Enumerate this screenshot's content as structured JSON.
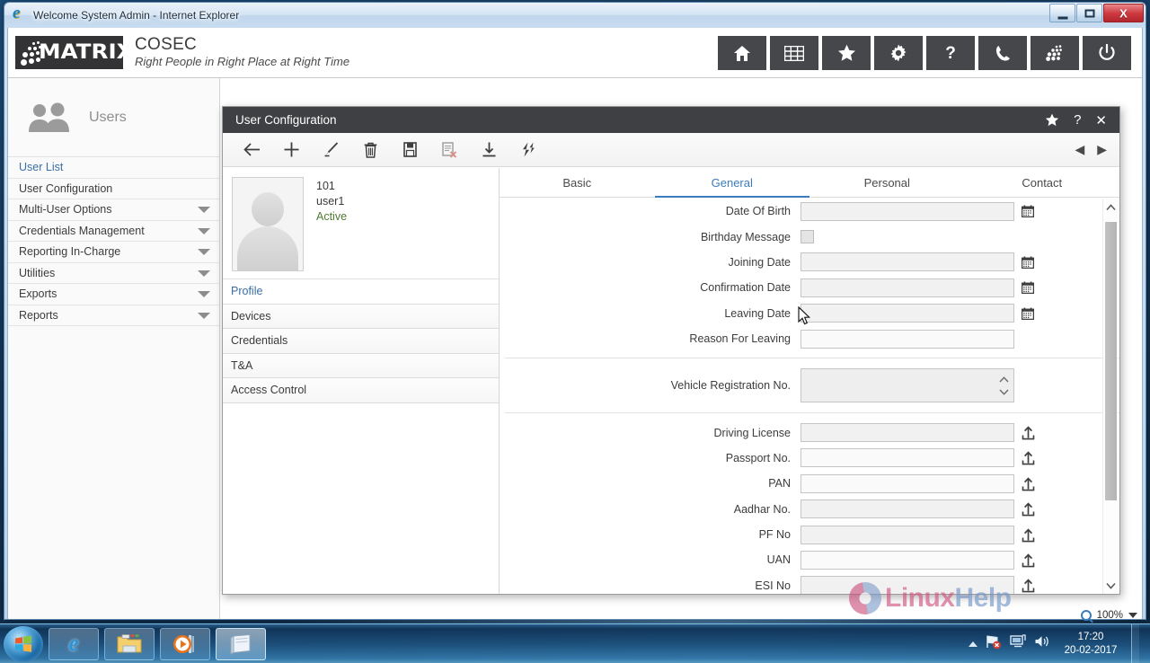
{
  "window": {
    "title": "Welcome System Admin - Internet Explorer",
    "icon": "internet-explorer-icon",
    "minimize_label": "Minimize",
    "maximize_label": "Maximize",
    "close_label": "X"
  },
  "app_header": {
    "logo_word": "MATRIX",
    "product": "COSEC",
    "tagline": "Right People in Right Place at Right Time",
    "icons": [
      {
        "name": "home-icon",
        "label": "Home"
      },
      {
        "name": "grid-icon",
        "label": "Modules"
      },
      {
        "name": "star-icon",
        "label": "Favourites"
      },
      {
        "name": "gear-icon",
        "label": "Settings"
      },
      {
        "name": "help-icon",
        "label": "?"
      },
      {
        "name": "phone-icon",
        "label": "Contact"
      },
      {
        "name": "dots-matrix-icon",
        "label": "Matrix"
      },
      {
        "name": "power-icon",
        "label": "Logout"
      }
    ]
  },
  "sidebar": {
    "heading": "Users",
    "heading_icon": "users-icon",
    "items": [
      {
        "label": "User List",
        "active": true,
        "caret": false
      },
      {
        "label": "User Configuration",
        "active": false,
        "caret": false
      },
      {
        "label": "Multi-User Options",
        "active": false,
        "caret": true
      },
      {
        "label": "Credentials Management",
        "active": false,
        "caret": true
      },
      {
        "label": "Reporting In-Charge",
        "active": false,
        "caret": true
      },
      {
        "label": "Utilities",
        "active": false,
        "caret": true
      },
      {
        "label": "Exports",
        "active": false,
        "caret": true
      },
      {
        "label": "Reports",
        "active": false,
        "caret": true
      }
    ]
  },
  "dialog": {
    "title": "User Configuration",
    "title_actions": [
      {
        "name": "favourite-star-icon",
        "glyph": "★"
      },
      {
        "name": "help-icon",
        "glyph": "?"
      },
      {
        "name": "close-icon",
        "glyph": "✕"
      }
    ],
    "toolbar": [
      {
        "name": "back-icon",
        "label": "Back"
      },
      {
        "name": "add-icon",
        "label": "Add"
      },
      {
        "name": "edit-pencil-icon",
        "label": "Edit"
      },
      {
        "name": "delete-trash-icon",
        "label": "Delete"
      },
      {
        "name": "save-icon",
        "label": "Save"
      },
      {
        "name": "cancel-document-icon",
        "label": "Cancel"
      },
      {
        "name": "import-icon",
        "label": "Import"
      },
      {
        "name": "refresh-icon",
        "label": "Refresh"
      }
    ],
    "nav_prev": "◀",
    "nav_next": "▶"
  },
  "user_panel": {
    "avatar": "user-avatar-placeholder",
    "id": "101",
    "name": "user1",
    "status": "Active",
    "items": [
      {
        "label": "Profile",
        "active": true
      },
      {
        "label": "Devices",
        "active": false
      },
      {
        "label": "Credentials",
        "active": false
      },
      {
        "label": "T&A",
        "active": false
      },
      {
        "label": "Access Control",
        "active": false
      }
    ]
  },
  "form": {
    "tabs": [
      {
        "label": "Basic",
        "active": false
      },
      {
        "label": "General",
        "active": true
      },
      {
        "label": "Personal",
        "active": false
      },
      {
        "label": "Contact",
        "active": false
      }
    ],
    "fields": [
      {
        "label": "Date Of Birth",
        "type": "date",
        "value": "",
        "icon": "calendar-icon"
      },
      {
        "label": "Birthday Message",
        "type": "checkbox",
        "value": "",
        "checked": false
      },
      {
        "label": "Joining Date",
        "type": "date",
        "value": "",
        "icon": "calendar-icon"
      },
      {
        "label": "Confirmation Date",
        "type": "date",
        "value": "",
        "icon": "calendar-icon"
      },
      {
        "label": "Leaving Date",
        "type": "date",
        "value": "",
        "icon": "calendar-icon"
      },
      {
        "label": "Reason For Leaving",
        "type": "text",
        "value": ""
      },
      {
        "label": "Vehicle Registration No.",
        "type": "spinner",
        "value": ""
      },
      {
        "label": "Driving License",
        "type": "text",
        "value": "",
        "icon": "upload-icon"
      },
      {
        "label": "Passport No.",
        "type": "text",
        "value": "",
        "icon": "upload-icon"
      },
      {
        "label": "PAN",
        "type": "text",
        "value": "",
        "icon": "upload-icon"
      },
      {
        "label": "Aadhar No.",
        "type": "text",
        "value": "",
        "icon": "upload-icon"
      },
      {
        "label": "PF No",
        "type": "text",
        "value": "",
        "icon": "upload-icon"
      },
      {
        "label": "UAN",
        "type": "text",
        "value": "",
        "icon": "upload-icon"
      },
      {
        "label": "ESI No",
        "type": "text",
        "value": "",
        "icon": "upload-icon"
      }
    ],
    "scrollbar": {
      "up": "⌃",
      "down": "⌄"
    }
  },
  "watermark": {
    "part_a": "Linux",
    "part_b": "Help"
  },
  "status": {
    "zoom": "100%"
  },
  "taskbar": {
    "start_label": "Start",
    "items": [
      {
        "name": "taskbar-internet-explorer",
        "active": false
      },
      {
        "name": "taskbar-windows-explorer",
        "active": false
      },
      {
        "name": "taskbar-media-player",
        "active": false
      },
      {
        "name": "taskbar-active-window",
        "active": true
      }
    ],
    "tray": [
      {
        "name": "tray-show-hidden-icon",
        "glyph": "▲"
      },
      {
        "name": "tray-network-icon",
        "glyph": "network"
      },
      {
        "name": "tray-action-center-icon",
        "glyph": "flag"
      },
      {
        "name": "tray-volume-icon",
        "glyph": "speaker"
      }
    ],
    "time": "17:20",
    "date": "20-02-2017"
  },
  "colors": {
    "accent_blue": "#3a7cbd",
    "header_dark": "#46474a",
    "dialog_title": "#3f4043",
    "status_green": "#4f7a33",
    "link_blue": "#3a6ea5"
  }
}
